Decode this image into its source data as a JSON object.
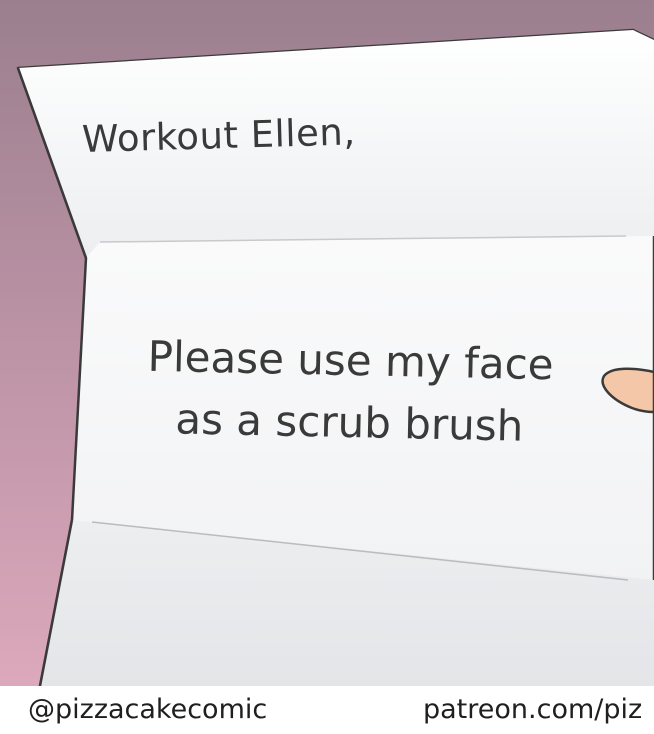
{
  "letter": {
    "greeting": "Workout Ellen,",
    "message_line1": "Please use my face",
    "message_line2": "as a scrub brush"
  },
  "footer": {
    "handle": "@pizzacakecomic",
    "patreon": "patreon.com/piz"
  },
  "colors": {
    "background_top": "#9b7f8e",
    "background_bottom": "#dca8bc",
    "paper": "#f4f5f6",
    "outline": "#3a3a3a",
    "skin": "#f3c7a8"
  }
}
